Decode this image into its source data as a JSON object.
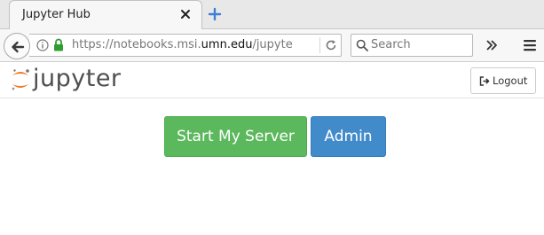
{
  "browser": {
    "tab_title": "Jupyter Hub",
    "tab_close_icon": "close-icon",
    "new_tab_icon": "plus-icon",
    "back_icon": "arrow-left-icon",
    "url_prefix": "https://notebooks.msi.",
    "url_host": "umn.edu",
    "url_suffix": "/jupyte",
    "reload_icon": "reload-icon",
    "search_placeholder": "Search",
    "overflow_icon": "double-chevron-right-icon",
    "menu_icon": "hamburger-menu-icon"
  },
  "header": {
    "logo_text": "jupyter",
    "logout_label": "Logout",
    "logout_icon": "sign-out-icon"
  },
  "main": {
    "start_label": "Start My Server",
    "admin_label": "Admin"
  },
  "colors": {
    "start_button": "#5cb85c",
    "admin_button": "#428bca",
    "jupyter_orange": "#f37726"
  }
}
